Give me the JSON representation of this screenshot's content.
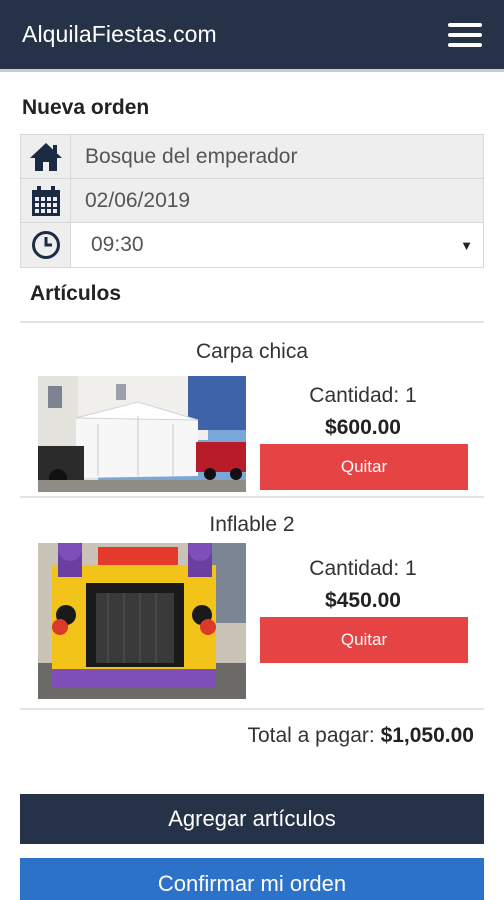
{
  "app": {
    "brand": "AlquilaFiestas.com"
  },
  "page": {
    "title": "Nueva orden"
  },
  "order": {
    "location": "Bosque del emperador",
    "date": "02/06/2019",
    "time": "09:30"
  },
  "articles": {
    "title": "Artículos",
    "items": [
      {
        "name": "Carpa chica",
        "quantity": "Cantidad: 1",
        "price": "$600.00",
        "remove_label": "Quitar"
      },
      {
        "name": "Inflable 2",
        "quantity": "Cantidad: 1",
        "price": "$450.00",
        "remove_label": "Quitar"
      }
    ]
  },
  "total": {
    "label": "Total a pagar:",
    "value": "$1,050.00"
  },
  "actions": {
    "add_label": "Agregar artículos",
    "confirm_label": "Confirmar mi orden"
  },
  "colors": {
    "navbar": "#253247",
    "danger": "#e64444",
    "primary": "#2c72c8"
  },
  "icons": [
    "hamburger-menu-icon",
    "home-icon",
    "calendar-icon",
    "clock-icon",
    "chevron-down-icon"
  ]
}
